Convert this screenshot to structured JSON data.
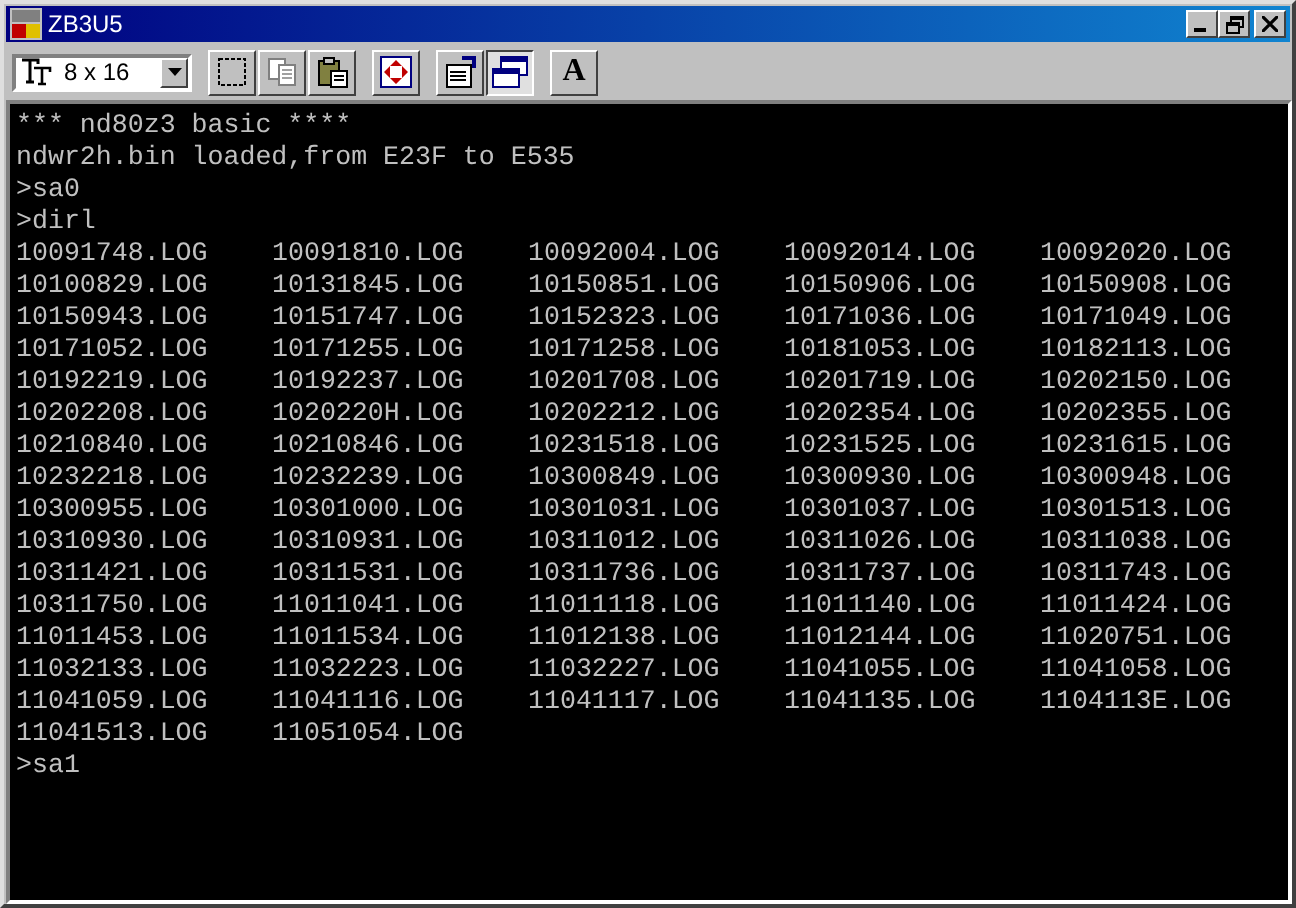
{
  "window": {
    "title": "ZB3U5"
  },
  "toolbar": {
    "font_size": "8 x 16",
    "buttons": [
      {
        "kind": "mark",
        "pressed": false
      },
      {
        "kind": "copy",
        "pressed": false
      },
      {
        "kind": "paste",
        "pressed": false
      },
      {
        "kind": "fullscreen",
        "pressed": false
      },
      {
        "kind": "properties",
        "pressed": false
      },
      {
        "kind": "background",
        "pressed": true
      },
      {
        "kind": "font",
        "label": "A",
        "pressed": false
      }
    ]
  },
  "console": {
    "lines_before": [
      "*** nd80z3 basic ****",
      "ndwr2h.bin loaded,from E23F to E535",
      ">sa0",
      ">dirl"
    ],
    "files": [
      "10091748.LOG",
      "10091810.LOG",
      "10092004.LOG",
      "10092014.LOG",
      "10092020.LOG",
      "10100829.LOG",
      "10131845.LOG",
      "10150851.LOG",
      "10150906.LOG",
      "10150908.LOG",
      "10150943.LOG",
      "10151747.LOG",
      "10152323.LOG",
      "10171036.LOG",
      "10171049.LOG",
      "10171052.LOG",
      "10171255.LOG",
      "10171258.LOG",
      "10181053.LOG",
      "10182113.LOG",
      "10192219.LOG",
      "10192237.LOG",
      "10201708.LOG",
      "10201719.LOG",
      "10202150.LOG",
      "10202208.LOG",
      "1020220H.LOG",
      "10202212.LOG",
      "10202354.LOG",
      "10202355.LOG",
      "10210840.LOG",
      "10210846.LOG",
      "10231518.LOG",
      "10231525.LOG",
      "10231615.LOG",
      "10232218.LOG",
      "10232239.LOG",
      "10300849.LOG",
      "10300930.LOG",
      "10300948.LOG",
      "10300955.LOG",
      "10301000.LOG",
      "10301031.LOG",
      "10301037.LOG",
      "10301513.LOG",
      "10310930.LOG",
      "10310931.LOG",
      "10311012.LOG",
      "10311026.LOG",
      "10311038.LOG",
      "10311421.LOG",
      "10311531.LOG",
      "10311736.LOG",
      "10311737.LOG",
      "10311743.LOG",
      "10311750.LOG",
      "11011041.LOG",
      "11011118.LOG",
      "11011140.LOG",
      "11011424.LOG",
      "11011453.LOG",
      "11011534.LOG",
      "11012138.LOG",
      "11012144.LOG",
      "11020751.LOG",
      "11032133.LOG",
      "11032223.LOG",
      "11032227.LOG",
      "11041055.LOG",
      "11041058.LOG",
      "11041059.LOG",
      "11041116.LOG",
      "11041117.LOG",
      "11041135.LOG",
      "1104113E.LOG",
      "11041513.LOG",
      "11051054.LOG"
    ],
    "lines_after": [
      ">sa1"
    ]
  }
}
